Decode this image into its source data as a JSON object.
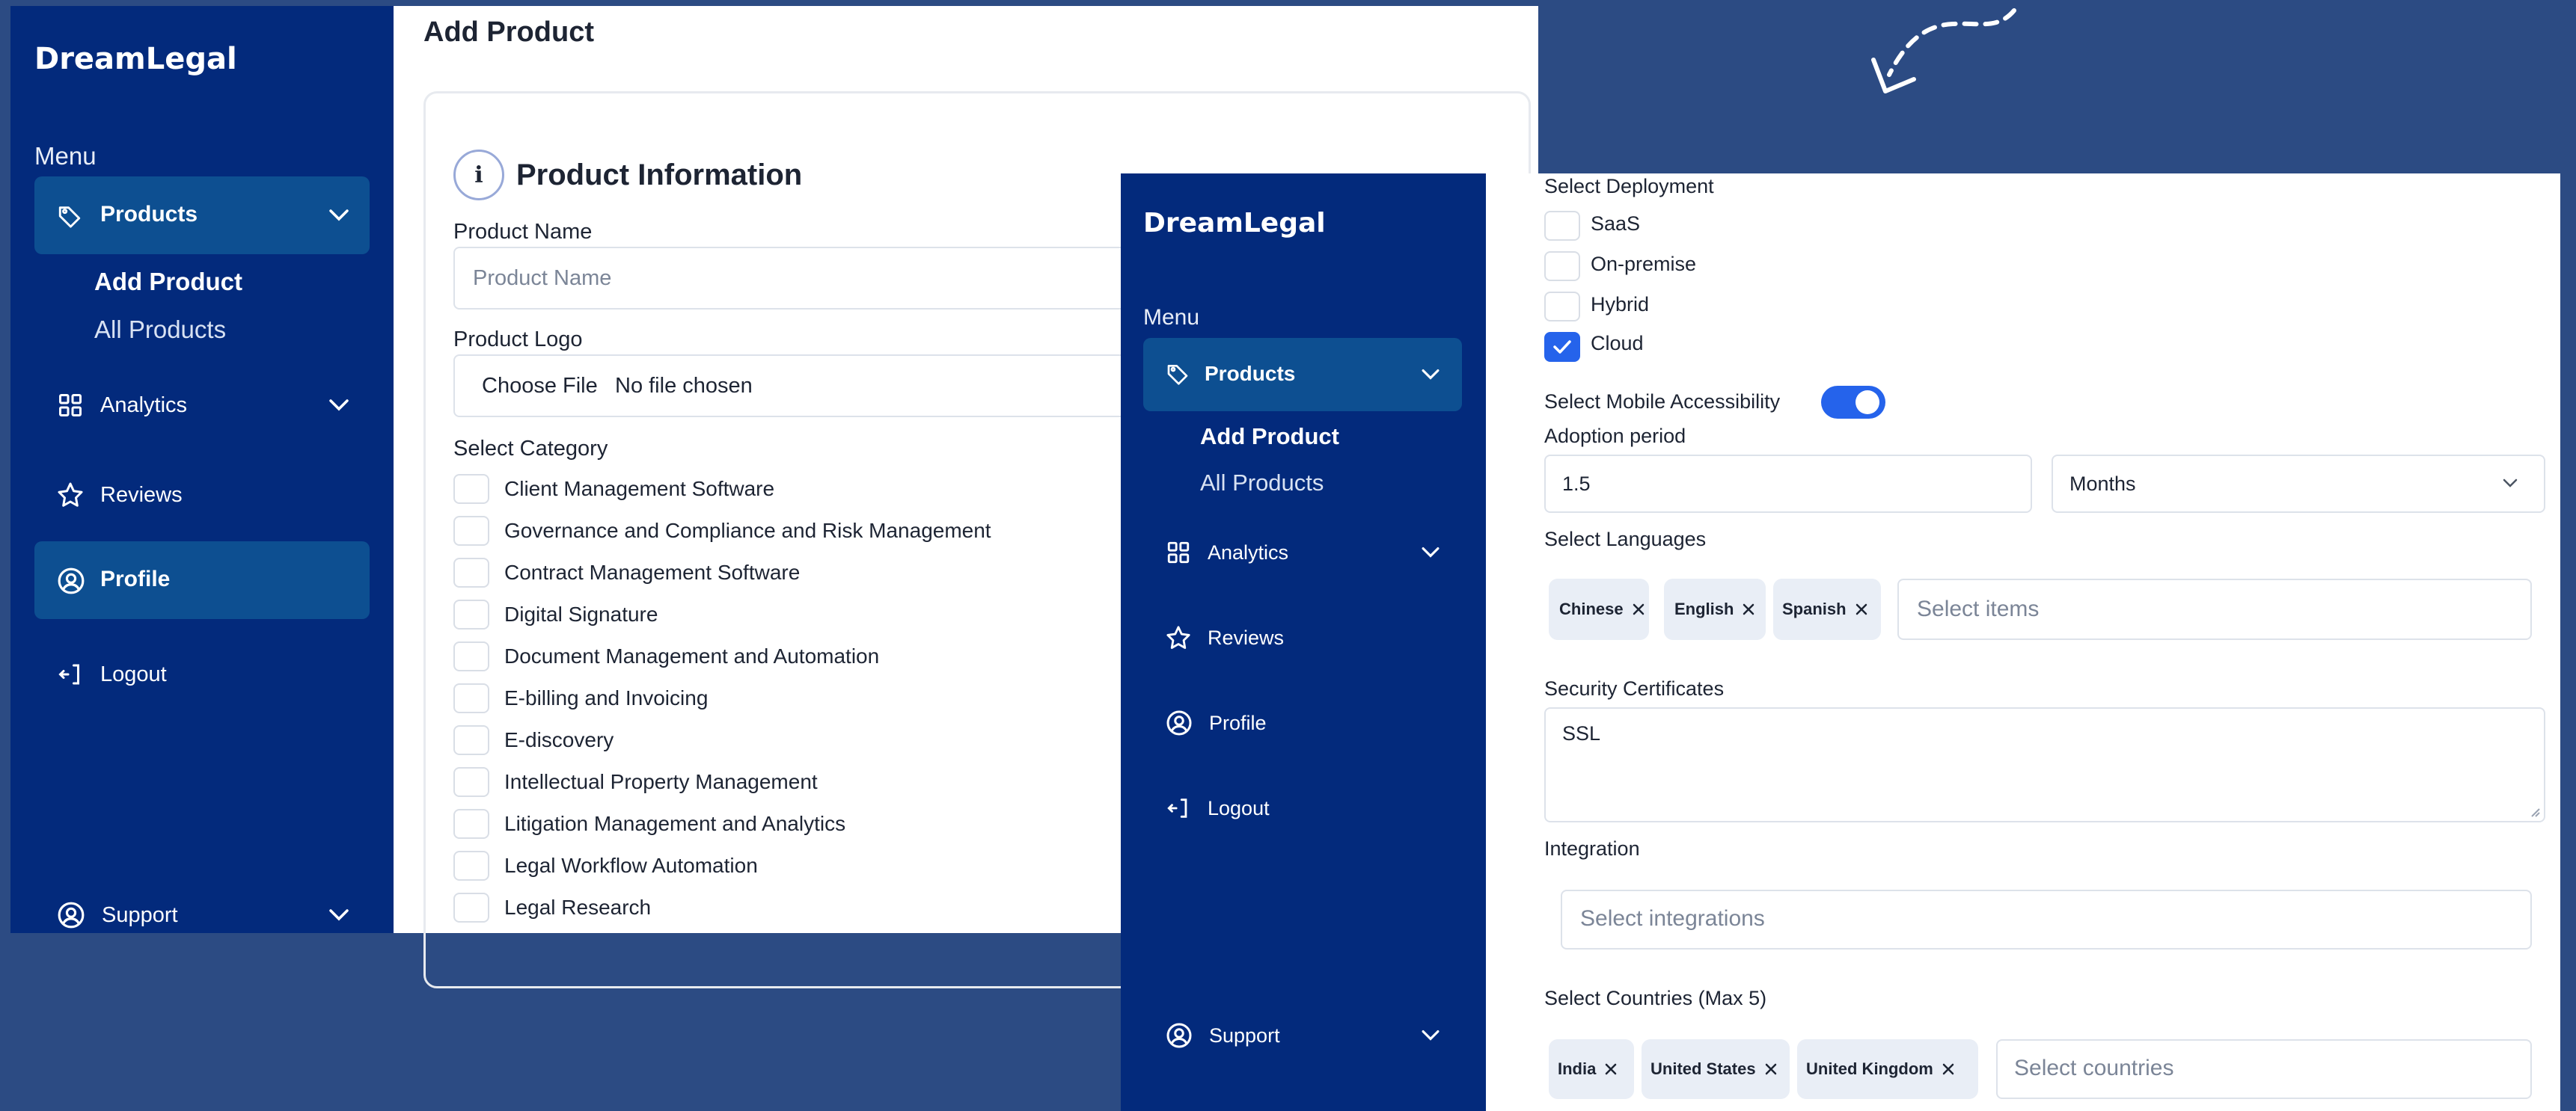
{
  "brand": "DreamLegal",
  "menu_label": "Menu",
  "nav": {
    "products": "Products",
    "add_product": "Add Product",
    "all_products": "All Products",
    "analytics": "Analytics",
    "reviews": "Reviews",
    "profile": "Profile",
    "logout": "Logout",
    "support": "Support"
  },
  "form1": {
    "page_title": "Add Product",
    "section_icon": "i",
    "section_title": "Product Information",
    "product_name_label": "Product Name",
    "product_name_placeholder": "Product Name",
    "product_logo_label": "Product Logo",
    "choose_file": "Choose File",
    "no_file": "No file chosen",
    "category_label": "Select Category",
    "categories": [
      "Client Management Software",
      "Governance and Compliance and Risk Management",
      "Contract Management Software",
      "Digital Signature",
      "Document Management and Automation",
      "E-billing and Invoicing",
      "E-discovery",
      "Intellectual Property Management",
      "Litigation Management and Analytics",
      "Legal Workflow Automation",
      "Legal Research"
    ]
  },
  "form2": {
    "deployment_label": "Select Deployment",
    "deployments": [
      "SaaS",
      "On-premise",
      "Hybrid",
      "Cloud"
    ],
    "mobile_label": "Select Mobile Accessibility",
    "adoption_label": "Adoption period",
    "adoption_value": "1.5",
    "adoption_unit": "Months",
    "languages_label": "Select Languages",
    "languages": [
      "Chinese",
      "English",
      "Spanish"
    ],
    "languages_placeholder": "Select items",
    "security_label": "Security Certificates",
    "security_value": "SSL",
    "integration_label": "Integration",
    "integration_placeholder": "Select integrations",
    "countries_label": "Select Countries (Max 5)",
    "countries": [
      "India",
      "United States",
      "United Kingdom"
    ],
    "countries_placeholder": "Select countries"
  },
  "state": {
    "cloud_checked": true,
    "mobile_toggle_on": true
  },
  "colors": {
    "sidebar": "#032a7c",
    "active": "#0d4f91",
    "background": "#2c4b83",
    "accent": "#2563eb"
  }
}
